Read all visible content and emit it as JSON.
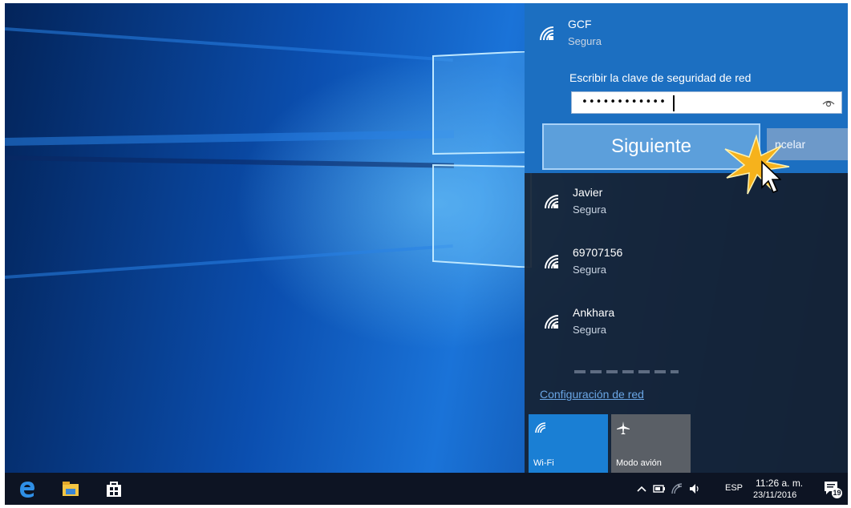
{
  "networks": [
    {
      "name": "GCF",
      "status": "Segura"
    },
    {
      "name": "Javier",
      "status": "Segura"
    },
    {
      "name": "69707156",
      "status": "Segura"
    },
    {
      "name": "Ankhara",
      "status": "Segura"
    }
  ],
  "password_prompt": {
    "label": "Escribir la clave de seguridad de red",
    "value": "••••••••••••"
  },
  "buttons": {
    "next": "Siguiente",
    "cancel": "ncelar"
  },
  "settings_link": "Configuración de red",
  "quick_actions": [
    {
      "label": "Wi-Fi",
      "active": true,
      "color": "#1a7fd4"
    },
    {
      "label": "Modo avión",
      "active": false,
      "color": "#5a5f66"
    }
  ],
  "taskbar": {
    "apps": [
      "edge-icon",
      "file-explorer-icon",
      "store-icon"
    ],
    "tray": {
      "language": "ESP",
      "time": "11:26 a. m.",
      "date": "23/11/2016",
      "notifications": "19"
    }
  },
  "colors": {
    "accent": "#1c6fc1",
    "flyout": "#16223a",
    "taskbar": "#0d1423"
  }
}
